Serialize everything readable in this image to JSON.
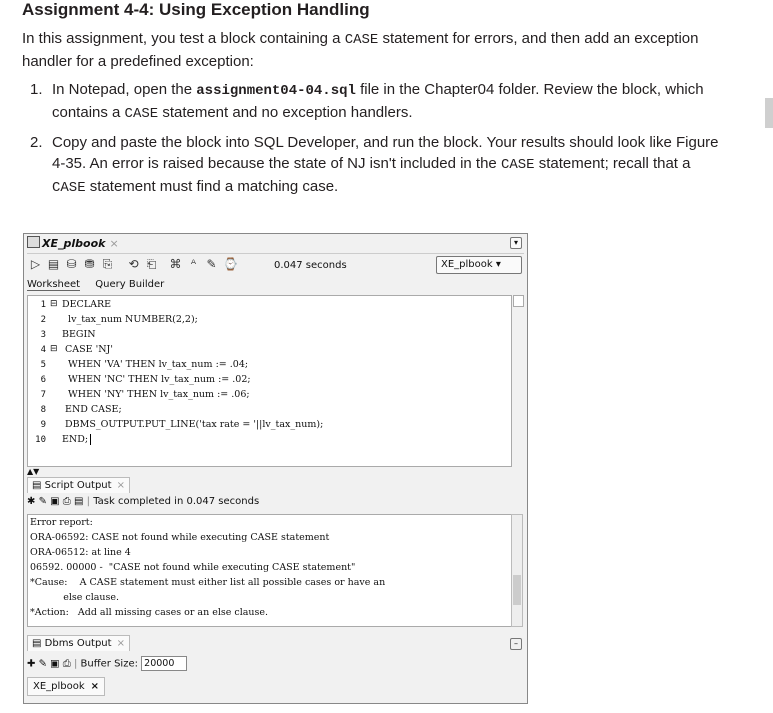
{
  "heading": "Assignment 4-4: Using Exception Handling",
  "intro": {
    "p1": "In this assignment, you test a block containing a ",
    "code1": "CASE",
    "p2": " statement for errors, and then add an exception handler for a predefined exception:"
  },
  "steps": [
    {
      "num": "1.",
      "a": "In Notepad, open the ",
      "file": "assignment04-04.sql",
      "b": " file in the Chapter04 folder. Review the block, which contains a ",
      "code": "CASE",
      "c": " statement and no exception handlers."
    },
    {
      "num": "2.",
      "a": "Copy and paste the block into SQL Developer, and run the block. Your results should look like Figure 4-35. An error is raised because the state of NJ isn't included in the ",
      "code": "CASE",
      "b": " statement; recall that a ",
      "code2": "CASE",
      "c": " statement must find a matching case."
    }
  ],
  "ide": {
    "tab_title": "XE_plbook",
    "tab_close": "×",
    "exec_time": "0.047 seconds",
    "connection": "XE_plbook ▾",
    "subtabs": [
      "Worksheet",
      "Query Builder"
    ],
    "code_lines": [
      {
        "n": "1",
        "t": "DECLARE"
      },
      {
        "n": "2",
        "t": "  lv_tax_num NUMBER(2,2);"
      },
      {
        "n": "3",
        "t": "BEGIN"
      },
      {
        "n": "4",
        "t": " CASE 'NJ'"
      },
      {
        "n": "5",
        "t": "  WHEN 'VA' THEN lv_tax_num := .04;"
      },
      {
        "n": "6",
        "t": "  WHEN 'NC' THEN lv_tax_num := .02;"
      },
      {
        "n": "7",
        "t": "  WHEN 'NY' THEN lv_tax_num := .06;"
      },
      {
        "n": "8",
        "t": " END CASE;"
      },
      {
        "n": "9",
        "t": " DBMS_OUTPUT.PUT_LINE('tax rate = '||lv_tax_num);"
      },
      {
        "n": "10",
        "t": "END;"
      }
    ],
    "script_output_tab": "Script Output",
    "task_status": "Task completed in 0.047 seconds",
    "output_lines": [
      "Error report:",
      "ORA-06592: CASE not found while executing CASE statement",
      "ORA-06512: at line 4",
      "06592. 00000 -  \"CASE not found while executing CASE statement\"",
      "*Cause:    A CASE statement must either list all possible cases or have an",
      "           else clause.",
      "*Action:   Add all missing cases or an else clause."
    ],
    "dbms_tab": "Dbms Output",
    "buffer_label": "Buffer Size:",
    "buffer_value": "20000",
    "connection_tab": "XE_plbook",
    "connection_tab_close": "×"
  }
}
